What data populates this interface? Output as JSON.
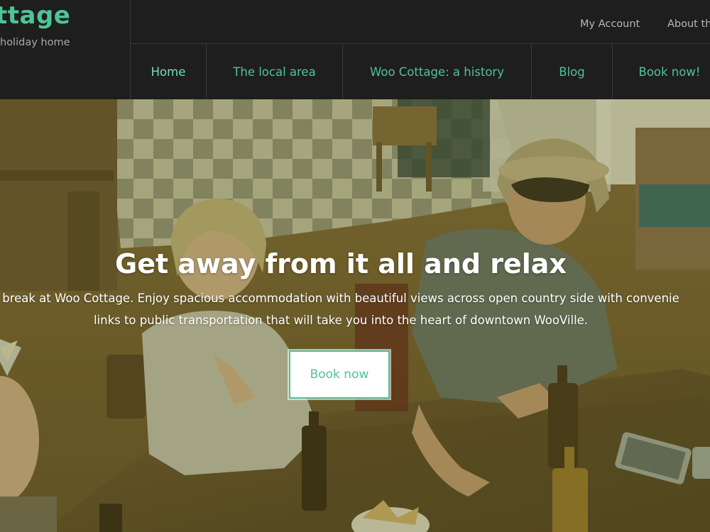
{
  "brand": {
    "title": "ttage",
    "tagline": "holiday home"
  },
  "top_links": {
    "account": "My Account",
    "about": "About th"
  },
  "nav": {
    "items": [
      {
        "label": "Home",
        "active": true
      },
      {
        "label": "The local area",
        "active": false
      },
      {
        "label": "Woo Cottage: a history",
        "active": false
      },
      {
        "label": "Blog",
        "active": false
      },
      {
        "label": "Book now!",
        "active": false
      }
    ]
  },
  "hero": {
    "title": "Get away from it all and relax",
    "text_line1": "break at Woo Cottage. Enjoy spacious accommodation with beautiful views across open country side with convenie",
    "text_line2": "links to public transportation that will take you into the heart of downtown WooVille.",
    "button_label": "Book now"
  },
  "colors": {
    "accent": "#4fc496",
    "header_bg": "#1e1e1e",
    "divider": "#3a3a3a",
    "muted_text": "#b7b7b7"
  }
}
